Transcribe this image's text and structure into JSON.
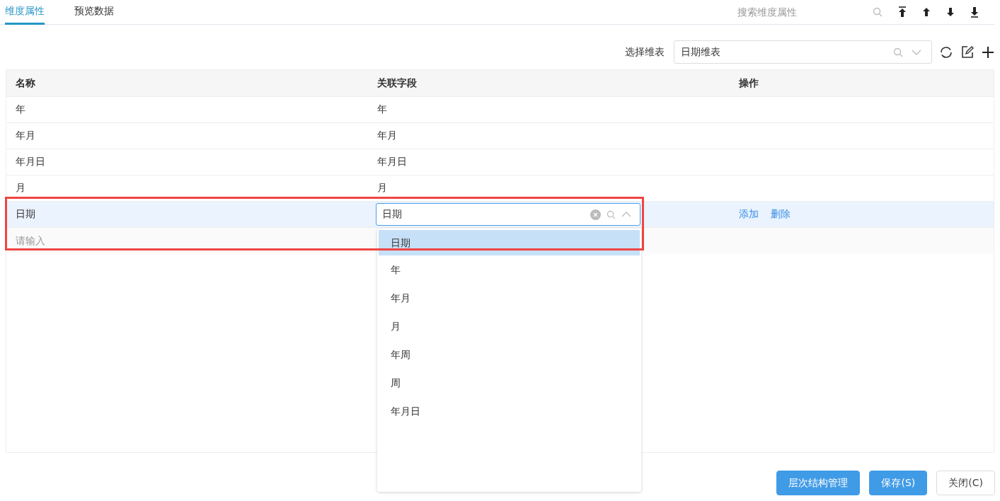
{
  "tabs": [
    {
      "label": "维度属性",
      "selected": true
    },
    {
      "label": "预览数据",
      "selected": false
    }
  ],
  "search": {
    "placeholder": "搜索维度属性"
  },
  "selector": {
    "label": "选择维表",
    "value": "日期维表"
  },
  "table": {
    "columns": [
      "名称",
      "关联字段",
      "操作"
    ],
    "rows": [
      {
        "kind": "plain",
        "name": "年",
        "field": "年"
      },
      {
        "kind": "plain",
        "name": "年月",
        "field": "年月"
      },
      {
        "kind": "plain",
        "name": "年月日",
        "field": "年月日"
      },
      {
        "kind": "plain",
        "name": "月",
        "field": "月"
      },
      {
        "kind": "editing",
        "name": "日期",
        "field": "日期",
        "actions": [
          "添加",
          "删除"
        ]
      },
      {
        "kind": "new",
        "placeholder": "请输入"
      }
    ]
  },
  "dropdown": {
    "options": [
      {
        "label": "日期",
        "selected": true
      },
      {
        "label": "年",
        "selected": false
      },
      {
        "label": "年月",
        "selected": false
      },
      {
        "label": "月",
        "selected": false
      },
      {
        "label": "年周",
        "selected": false
      },
      {
        "label": "周",
        "selected": false
      },
      {
        "label": "年月日",
        "selected": false
      }
    ]
  },
  "buttons": [
    {
      "label": "层次结构管理",
      "kind": "primary"
    },
    {
      "label": "保存(S)",
      "kind": "primary"
    },
    {
      "label": "关闭(C)",
      "kind": "default"
    }
  ]
}
